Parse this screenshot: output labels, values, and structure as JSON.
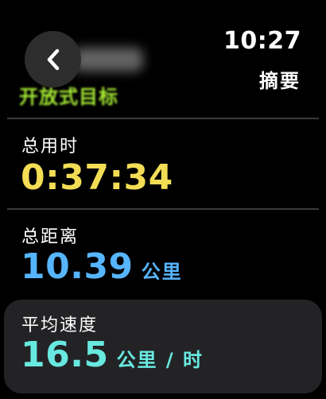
{
  "header": {
    "back_icon": "chevron-left-icon",
    "title": "摘要",
    "time": "10:27",
    "workout_title": "开放式目标"
  },
  "metrics": {
    "total_time": {
      "label": "总用时",
      "value": "0:37:34",
      "color": "#f3dd55"
    },
    "total_distance": {
      "label": "总距离",
      "value": "10.39",
      "unit": "公里",
      "color": "#57b5ff"
    },
    "average_speed": {
      "label": "平均速度",
      "value": "16.5",
      "unit": "公里 / 时",
      "color": "#68e9e0"
    }
  },
  "colors": {
    "background": "#000000",
    "divider": "#3a3a3c",
    "card": "#232326",
    "workout_title": "#b4ff3a"
  }
}
